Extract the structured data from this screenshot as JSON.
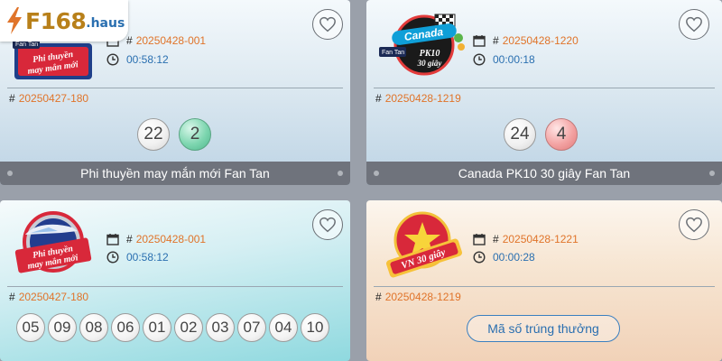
{
  "brand": {
    "main": "F168",
    "sub": ".haus"
  },
  "cards": [
    {
      "current_draw": "20250428-001",
      "timer": "00:58:12",
      "previous_draw": "20250427-180",
      "results": [
        "22",
        "2"
      ],
      "title": "Phi thuyền may mắn mới Fan Tan",
      "logo_text": [
        "Fan Tan",
        "Phi thuyền",
        "may mắn mới"
      ]
    },
    {
      "current_draw": "20250428-1220",
      "timer": "00:00:18",
      "previous_draw": "20250428-1219",
      "results": [
        "24",
        "4"
      ],
      "title": "Canada PK10 30 giây Fan Tan",
      "logo_text": [
        "Canada",
        "Fan Tan",
        "PK10",
        "30 giây"
      ]
    },
    {
      "current_draw": "20250428-001",
      "timer": "00:58:12",
      "previous_draw": "20250427-180",
      "results": [
        "05",
        "09",
        "08",
        "06",
        "01",
        "02",
        "03",
        "07",
        "04",
        "10"
      ],
      "logo_text": [
        "Phi thuyền",
        "may mắn mới"
      ]
    },
    {
      "current_draw": "20250428-1221",
      "timer": "00:00:28",
      "previous_draw": "20250428-1219",
      "button_label": "Mã số trúng thưởng",
      "logo_text": [
        "VN 30 giây"
      ]
    }
  ],
  "icons": {
    "favorite": "heart-outline-icon",
    "calendar": "calendar-icon",
    "clock": "clock-icon"
  },
  "colors": {
    "draw_id": "#e0742a",
    "timer": "#2a6fb0",
    "footer": "#6f737c",
    "brand_gold": "#b8801a",
    "brand_blue": "#2a6fb0",
    "green_ball": "#7ed6b0",
    "red_ball": "#f3a3a3"
  }
}
